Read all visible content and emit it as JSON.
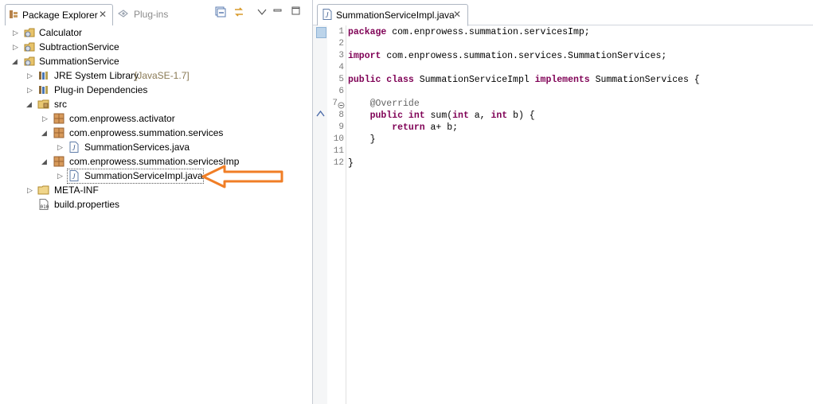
{
  "left_panel": {
    "tabs": [
      {
        "label": "Package Explorer",
        "active": true,
        "close": "✕"
      },
      {
        "label": "Plug-ins",
        "active": false
      }
    ],
    "toolbar": [
      "collapse-all-icon",
      "link-with-editor-icon",
      "view-menu-icon",
      "minimize-icon",
      "maximize-icon"
    ],
    "tree": [
      {
        "label": "Calculator",
        "icon": "plugin-project-icon",
        "expanded": false
      },
      {
        "label": "SubtractionService",
        "icon": "plugin-project-icon",
        "expanded": false
      },
      {
        "label": "SummationService",
        "icon": "plugin-project-icon",
        "expanded": true
      },
      {
        "label": "JRE System Library",
        "suffix": "[JavaSE-1.7]",
        "icon": "library-icon",
        "expanded": false
      },
      {
        "label": "Plug-in Dependencies",
        "icon": "library-icon",
        "expanded": false
      },
      {
        "label": "src",
        "icon": "source-folder-icon",
        "expanded": true
      },
      {
        "label": "com.enprowess.activator",
        "icon": "package-icon",
        "expanded": false
      },
      {
        "label": "com.enprowess.summation.services",
        "icon": "package-icon",
        "expanded": true
      },
      {
        "label": "SummationServices.java",
        "icon": "java-file-icon",
        "expanded": false
      },
      {
        "label": "com.enprowess.summation.servicesImp",
        "icon": "package-icon",
        "expanded": true
      },
      {
        "label": "SummationServiceImpl.java",
        "icon": "java-file-icon",
        "expanded": false,
        "selected": true
      },
      {
        "label": "META-INF",
        "icon": "folder-icon",
        "expanded": false
      },
      {
        "label": "build.properties",
        "icon": "properties-file-icon",
        "expanded": null
      }
    ],
    "annotation_arrow_color": "#f07e26"
  },
  "editor": {
    "tab": {
      "label": "SummationServiceImpl.java",
      "close": "✕"
    },
    "line_numbers": [
      "1",
      "2",
      "3",
      "4",
      "5",
      "6",
      "7",
      "8",
      "9",
      "10",
      "11",
      "12"
    ],
    "lines": [
      {
        "kw": "package",
        "rest": " com.enprowess.summation.servicesImp;"
      },
      {
        "kw": "",
        "rest": ""
      },
      {
        "kw": "import",
        "rest": " com.enprowess.summation.services.SummationServices;"
      },
      {
        "kw": "",
        "rest": ""
      },
      {
        "kw": "public class",
        "rest": " SummationServiceImpl ",
        "kw2": "implements",
        "rest2": " SummationServices {"
      },
      {
        "kw": "",
        "rest": ""
      },
      {
        "ann": "    @Override"
      },
      {
        "kw": "    public int",
        "rest": " sum(",
        "kw2": "int",
        "rest2": " a, ",
        "kw3": "int",
        "rest3": " b) {"
      },
      {
        "kw": "        return",
        "rest": " a+ b;"
      },
      {
        "kw": "",
        "rest": "    }"
      },
      {
        "kw": "",
        "rest": ""
      },
      {
        "kw": "",
        "rest": "}"
      }
    ],
    "colors": {
      "keyword": "#7f0055",
      "annotation": "#646464"
    }
  }
}
